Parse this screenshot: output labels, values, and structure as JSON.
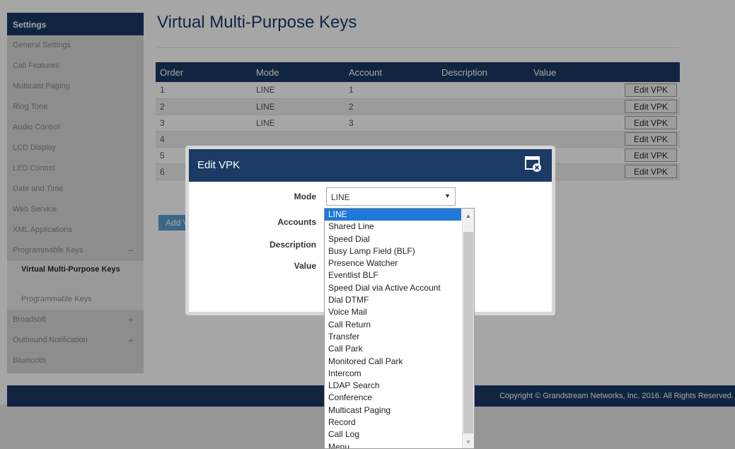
{
  "sidebar": {
    "header": "Settings",
    "items": [
      {
        "label": "General Settings"
      },
      {
        "label": "Call Features"
      },
      {
        "label": "Multicast Paging"
      },
      {
        "label": "Ring Tone"
      },
      {
        "label": "Audio Control"
      },
      {
        "label": "LCD Display"
      },
      {
        "label": "LED Control"
      },
      {
        "label": "Date and Time"
      },
      {
        "label": "Web Service"
      },
      {
        "label": "XML Applications"
      },
      {
        "label": "Programmable Keys",
        "toggle": "−"
      }
    ],
    "sub_items": [
      {
        "label": "Virtual Multi-Purpose Keys",
        "active": true
      },
      {
        "label": "Programmable Keys"
      }
    ],
    "after_items": [
      {
        "label": "Broadsoft",
        "toggle": "+"
      },
      {
        "label": "Outbound Notification",
        "toggle": "+"
      },
      {
        "label": "Bluetooth"
      }
    ]
  },
  "page": {
    "title": "Virtual Multi-Purpose Keys"
  },
  "table": {
    "headers": [
      "Order",
      "Mode",
      "Account",
      "Description",
      "Value"
    ],
    "rows": [
      {
        "order": "1",
        "mode": "LINE",
        "account": "1"
      },
      {
        "order": "2",
        "mode": "LINE",
        "account": "2"
      },
      {
        "order": "3",
        "mode": "LINE",
        "account": "3"
      },
      {
        "order": "4",
        "mode": "",
        "account": ""
      },
      {
        "order": "5",
        "mode": "",
        "account": ""
      },
      {
        "order": "6",
        "mode": "",
        "account": ""
      }
    ],
    "edit_label": "Edit VPK"
  },
  "add_button": "Add V",
  "footer": "Copyright © Grandstream Networks, Inc. 2016. All Rights Reserved.",
  "modal": {
    "title": "Edit VPK",
    "fields": {
      "mode_label": "Mode",
      "accounts_label": "Accounts",
      "description_label": "Description",
      "value_label": "Value"
    },
    "mode_value": "LINE",
    "dropdown_options": [
      "LINE",
      "Shared Line",
      "Speed Dial",
      "Busy Lamp Field (BLF)",
      "Presence Watcher",
      "Eventlist BLF",
      "Speed Dial via Active Account",
      "Dial DTMF",
      "Voice Mail",
      "Call Return",
      "Transfer",
      "Call Park",
      "Monitored Call Park",
      "Intercom",
      "LDAP Search",
      "Conference",
      "Multicast Paging",
      "Record",
      "Call Log",
      "Menu"
    ],
    "selected_option": "LINE"
  },
  "colors": {
    "navy": "#1b3a64",
    "highlight": "#1e79d8",
    "add_button": "#5a9fcf"
  }
}
